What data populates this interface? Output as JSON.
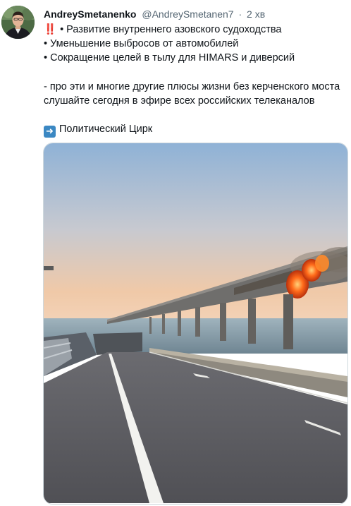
{
  "tweet": {
    "author": {
      "display_name": "AndreySmetanenko",
      "handle": "@AndreySmetanen7",
      "separator": "·",
      "time": "2 хв"
    },
    "lines": [
      {
        "emoji": "‼️",
        "text": "• Развитие внутреннего азовского судоходства"
      },
      {
        "text": "• Уменьшение выбросов от автомобилей"
      },
      {
        "text": "• Сокращение целей в тылу для HIMARS и диверсий"
      },
      {
        "text": "- про эти и многие другие плюсы жизни без керченского моста"
      },
      {
        "text": "слушайте сегодня в эфире всех российских телеканалов"
      },
      {
        "emoji": "➡️",
        "text": "Политический Цирк"
      }
    ],
    "media": {
      "type": "video-still",
      "description_icon": "video-thumbnail"
    }
  },
  "colors": {
    "text_primary": "#0f1419",
    "text_secondary": "#536471",
    "emoji_red": "#d8232a",
    "emoji_blue": "#3b88c3",
    "fire": "#ff6a1a",
    "sky_top": "#8fb2d6",
    "sky_bottom": "#f0c9a8"
  }
}
